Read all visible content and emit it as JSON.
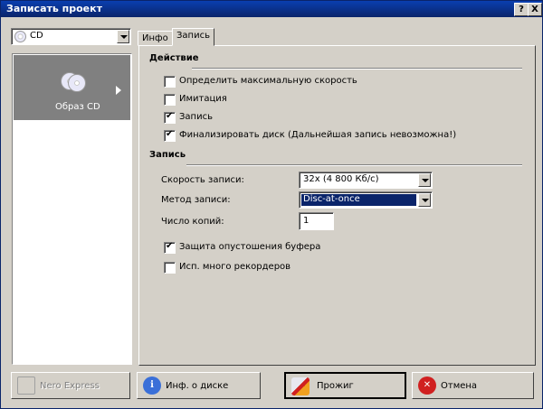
{
  "window": {
    "title": "Записать проект"
  },
  "title_buttons": {
    "help": "?",
    "close": "X"
  },
  "left": {
    "combo_value": "CD",
    "items": [
      {
        "label": "Образ CD"
      }
    ]
  },
  "tabs": [
    {
      "label": "Инфо"
    },
    {
      "label": "Запись"
    }
  ],
  "action": {
    "heading": "Действие",
    "checks": [
      {
        "label": "Определить максимальную скорость",
        "checked": false
      },
      {
        "label": "Имитация",
        "checked": false
      },
      {
        "label": "Запись",
        "checked": true
      },
      {
        "label": "Финализировать диск (Дальнейшая запись невозможна!)",
        "checked": true
      }
    ]
  },
  "write": {
    "heading": "Запись",
    "speed_label": "Скорость записи:",
    "speed_value": "32x (4 800 Кб/с)",
    "method_label": "Метод записи:",
    "method_value": "Disc-at-once",
    "copies_label": "Число копий:",
    "copies_value": "1",
    "checks": [
      {
        "label": "Защита опустошения буфера",
        "checked": true
      },
      {
        "label": "Исп. много рекордеров",
        "checked": false
      }
    ]
  },
  "buttons": {
    "nero_express": "Nero Express",
    "disc_info": "Инф. о диске",
    "burn": "Прожиг",
    "cancel": "Отмена"
  },
  "colors": {
    "titlebar": "#0a246a",
    "selection": "#0a246a",
    "face": "#d4d0c8"
  }
}
